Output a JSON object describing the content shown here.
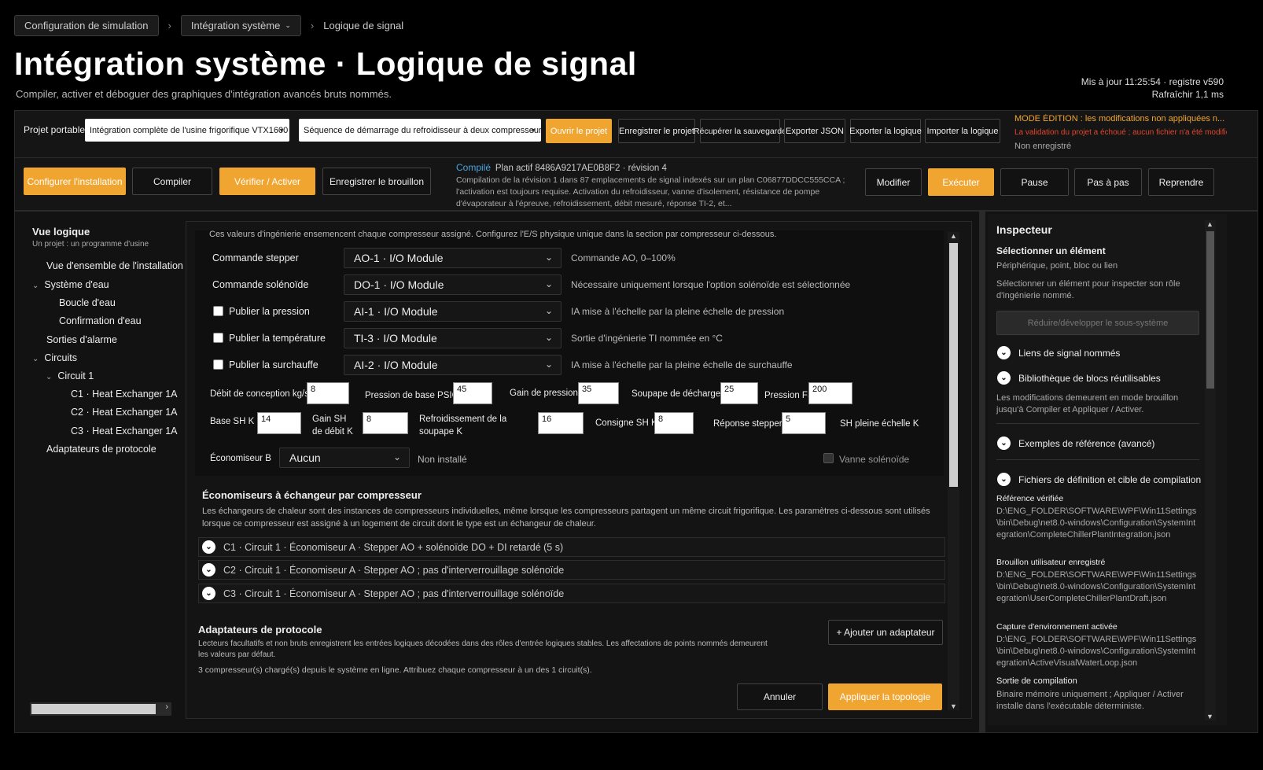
{
  "breadcrumb": {
    "item1": "Configuration de simulation",
    "item2": "Intégration système",
    "current": "Logique de signal"
  },
  "header": {
    "title": "Intégration système · Logique de signal",
    "subtitle": "Compiler, activer et déboguer des graphiques d'intégration avancés bruts nommés.",
    "updated_line1": "Mis à jour 11:25:54 · registre v590",
    "updated_line2": "Rafraîchir 1,1 ms"
  },
  "toolbar": {
    "project_label": "Projet portable",
    "project_select": "Intégration complète de l'usine frigorifique VTX1600",
    "sequence_select": "Séquence de démarrage du refroidisseur à deux compresseurs, r",
    "open_project": "Ouvrir le projet",
    "save_project": "Enregistrer le projet",
    "recover_save": "Récupérer la sauvegarde",
    "export_json": "Exporter JSON",
    "export_logic": "Exporter la logique",
    "import_logic": "Importer la logique",
    "warn_mode": "MODE ÉDITION : les modifications non appliquées n...",
    "warn_fail": "La validation du projet a échoué ; aucun fichier n'a été modifié.",
    "not_saved": "Non enregistré"
  },
  "actions": {
    "configure": "Configurer l'installation",
    "compile": "Compiler",
    "verify": "Vérifier / Activer",
    "save_draft": "Enregistrer le brouillon",
    "compiled_label": "Compilé",
    "plan": "Plan actif 8486A9217AE0B8F2 · révision 4",
    "compile_desc": "Compilation de la révision 1 dans 87 emplacements de signal indexés sur un plan C06877DDCC555CCA ; l'activation est toujours requise. Activation du refroidisseur, vanne d'isolement, résistance de pompe d'évaporateur à l'épreuve, refroidissement, débit mesuré, réponse TI-2, et...",
    "modify": "Modifier",
    "execute": "Exécuter",
    "pause": "Pause",
    "step": "Pas à pas",
    "resume": "Reprendre"
  },
  "leftnav": {
    "title": "Vue logique",
    "subtitle": "Un projet : un programme d'usine",
    "items": [
      "Vue d'ensemble de l'installation",
      "Système d'eau",
      "Boucle d'eau",
      "Confirmation d'eau",
      "Sorties d'alarme",
      "Circuits",
      "Circuit 1",
      "C1 · Heat Exchanger 1A",
      "C2 · Heat Exchanger 1A",
      "C3 · Heat Exchanger 1A",
      "Adaptateurs de protocole"
    ]
  },
  "main": {
    "intro": "Ces valeurs d'ingénierie ensemencent chaque compresseur assigné. Configurez l'E/S physique unique dans la section par compresseur ci-dessous.",
    "rows": [
      {
        "label": "Commande stepper",
        "value": "AO-1 · I/O Module",
        "hint": "Commande AO, 0–100%"
      },
      {
        "label": "Commande solénoïde",
        "value": "DO-1 · I/O Module",
        "hint": "Nécessaire uniquement lorsque l'option solénoïde est sélectionnée"
      },
      {
        "label": "Publier la pression",
        "value": "AI-1 · I/O Module",
        "hint": "IA mise à l'échelle par la pleine échelle de pression"
      },
      {
        "label": "Publier la température",
        "value": "TI-3 · I/O Module",
        "hint": "Sortie d'ingénierie TI nommée en °C"
      },
      {
        "label": "Publier la surchauffe",
        "value": "AI-2 · I/O Module",
        "hint": "IA mise à l'échelle par la pleine échelle de surchauffe"
      }
    ],
    "params1": [
      {
        "label": "Débit de conception kg/s",
        "value": "8"
      },
      {
        "label": "Pression de base PSIG",
        "value": "45"
      },
      {
        "label": "Gain de pression",
        "value": "35"
      },
      {
        "label": "Soupape de décharge",
        "value": "25"
      },
      {
        "label": "Pression FS",
        "value": "200"
      }
    ],
    "params2": [
      {
        "label": "Base SH K",
        "value": "14"
      },
      {
        "label_a": "Gain SH",
        "label_b": "de débit K",
        "value": "8"
      },
      {
        "label_a": "Refroidissement de la",
        "label_b": "soupape K",
        "value": "16"
      },
      {
        "label": "Consigne SH K",
        "value": "8"
      },
      {
        "label": "Réponse stepper s",
        "value": "5"
      },
      {
        "label": "SH pleine échelle K"
      }
    ],
    "economizer_label": "Économiseur B",
    "economizer_value": "Aucun",
    "economizer_hint": "Non installé",
    "solenoid_valve": "Vanne solénoïde",
    "section_title": "Économiseurs à échangeur par compresseur",
    "section_desc": "Les échangeurs de chaleur sont des instances de compresseurs individuelles, même lorsque les compresseurs partagent un même circuit frigorifique. Les paramètres ci-dessous sont utilisés lorsque ce compresseur est assigné à un logement de circuit dont le type est un échangeur de chaleur.",
    "accordions": [
      "C1 · Circuit 1 · Économiseur A · Stepper AO + solénoïde DO + DI retardé (5 s)",
      "C2 · Circuit 1 · Économiseur A · Stepper AO ; pas d'interverrouillage solénoïde",
      "C3 · Circuit 1 · Économiseur A · Stepper AO ; pas d'interverrouillage solénoïde"
    ],
    "adapters_title": "Adaptateurs de protocole",
    "adapters_desc": "Lecteurs facultatifs et non bruts enregistrent les entrées logiques décodées dans des rôles d'entrée logiques stables. Les affectations de points nommés demeurent les valeurs par défaut.",
    "add_adapter": "+ Ajouter un adaptateur",
    "loaded_info": "3 compresseur(s) chargé(s) depuis le système en ligne. Attribuez chaque compresseur à un des 1 circuit(s).",
    "cancel": "Annuler",
    "apply": "Appliquer la topologie"
  },
  "inspector": {
    "title": "Inspecteur",
    "select_title": "Sélectionner un élément",
    "select_sub": "Périphérique, point, bloc ou lien",
    "select_desc": "Sélectionner un élément pour inspecter son rôle d'ingénierie nommé.",
    "collapse_btn": "Réduire/développer le sous-système",
    "item1": "Liens de signal nommés",
    "item2": "Bibliothèque de blocs réutilisables",
    "draft_note": "Les modifications demeurent en mode brouillon jusqu'à Compiler et Appliquer / Activer.",
    "item3": "Exemples de référence (avancé)",
    "item4": "Fichiers de définition et cible de compilation",
    "ref_title": "Référence vérifiée",
    "ref_path": "D:\\ENG_FOLDER\\SOFTWARE\\WPF\\Win11Settings\\bin\\Debug\\net8.0-windows\\Configuration\\SystemIntegration\\CompleteChillerPlantIntegration.json",
    "draft_title": "Brouillon utilisateur enregistré",
    "draft_path": "D:\\ENG_FOLDER\\SOFTWARE\\WPF\\Win11Settings\\bin\\Debug\\net8.0-windows\\Configuration\\SystemIntegration\\UserCompleteChillerPlantDraft.json",
    "env_title": "Capture d'environnement activée",
    "env_path": "D:\\ENG_FOLDER\\SOFTWARE\\WPF\\Win11Settings\\bin\\Debug\\net8.0-windows\\Configuration\\SystemIntegration\\ActiveVisualWaterLoop.json",
    "out_title": "Sortie de compilation",
    "out_desc": "Binaire mémoire uniquement ; Appliquer / Activer installe dans l'exécutable déterministe."
  },
  "colors": {
    "accent": "#f0a531",
    "link": "#4aa3e0",
    "error": "#e2462d"
  }
}
